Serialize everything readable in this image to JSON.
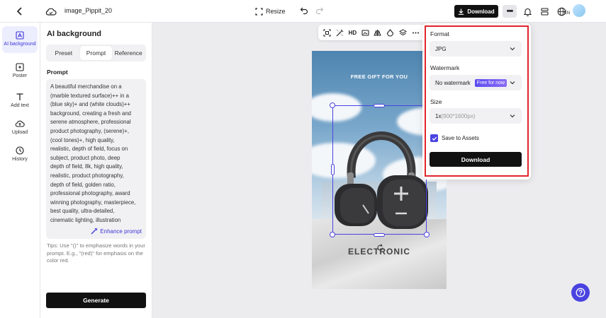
{
  "topbar": {
    "filename": "image_Pippit_20",
    "resize_label": "Resize",
    "download_label": "Download",
    "more_label": "•••",
    "lang_code": "EN"
  },
  "rail": {
    "items": [
      {
        "label": "AI background",
        "icon": "ai-background-icon",
        "active": true
      },
      {
        "label": "Poster",
        "icon": "poster-icon"
      },
      {
        "label": "Add text",
        "icon": "text-icon"
      },
      {
        "label": "Upload",
        "icon": "upload-icon"
      },
      {
        "label": "History",
        "icon": "history-icon"
      }
    ]
  },
  "panel": {
    "title": "AI background",
    "tabs": [
      "Preset",
      "Prompt",
      "Reference"
    ],
    "active_tab": "Prompt",
    "prompt_label": "Prompt",
    "prompt_text": "A beautiful merchandise on a\n(marble textured surface)++ in a\n(blue sky)+ and (white clouds)++\nbackground, creating a fresh and\nserene atmosphere, professional\nproduct photography, (serene)+,\n(cool tones)+, high quality,\nrealistic, depth of field, focus on\nsubject, product photo, deep\ndepth of field, 8k, high quality,\nrealistic, product photography,\ndepth of field, golden ratio,\nprofessional photography, award\nwinning photography, masterpiece,\nbest quality, ultra-detailed,\ncinematic lighting, illustration",
    "enhance_label": "Enhance prompt",
    "tips": "Tips: Use \"()\" to emphasize words in your prompt. E.g., \"(red)\" for emphasis on the color red.",
    "generate_label": "Generate"
  },
  "canvas_tools": {
    "hd_label": "HD"
  },
  "image": {
    "headline": "FREE GIFT FOR YOU",
    "footer": "ELECTRONIC"
  },
  "download_popover": {
    "format_label": "Format",
    "format_value": "JPG",
    "watermark_label": "Watermark",
    "watermark_value": "No watermark",
    "watermark_badge": "Free for now",
    "size_label": "Size",
    "size_value": "1x",
    "size_detail": "(900*1600px)",
    "save_label": "Save to Assets",
    "save_checked": true,
    "download_label": "Download",
    "highlight_color": "#e0252c"
  },
  "colors": {
    "accent": "#4a43e0",
    "dark_button": "#111111"
  }
}
